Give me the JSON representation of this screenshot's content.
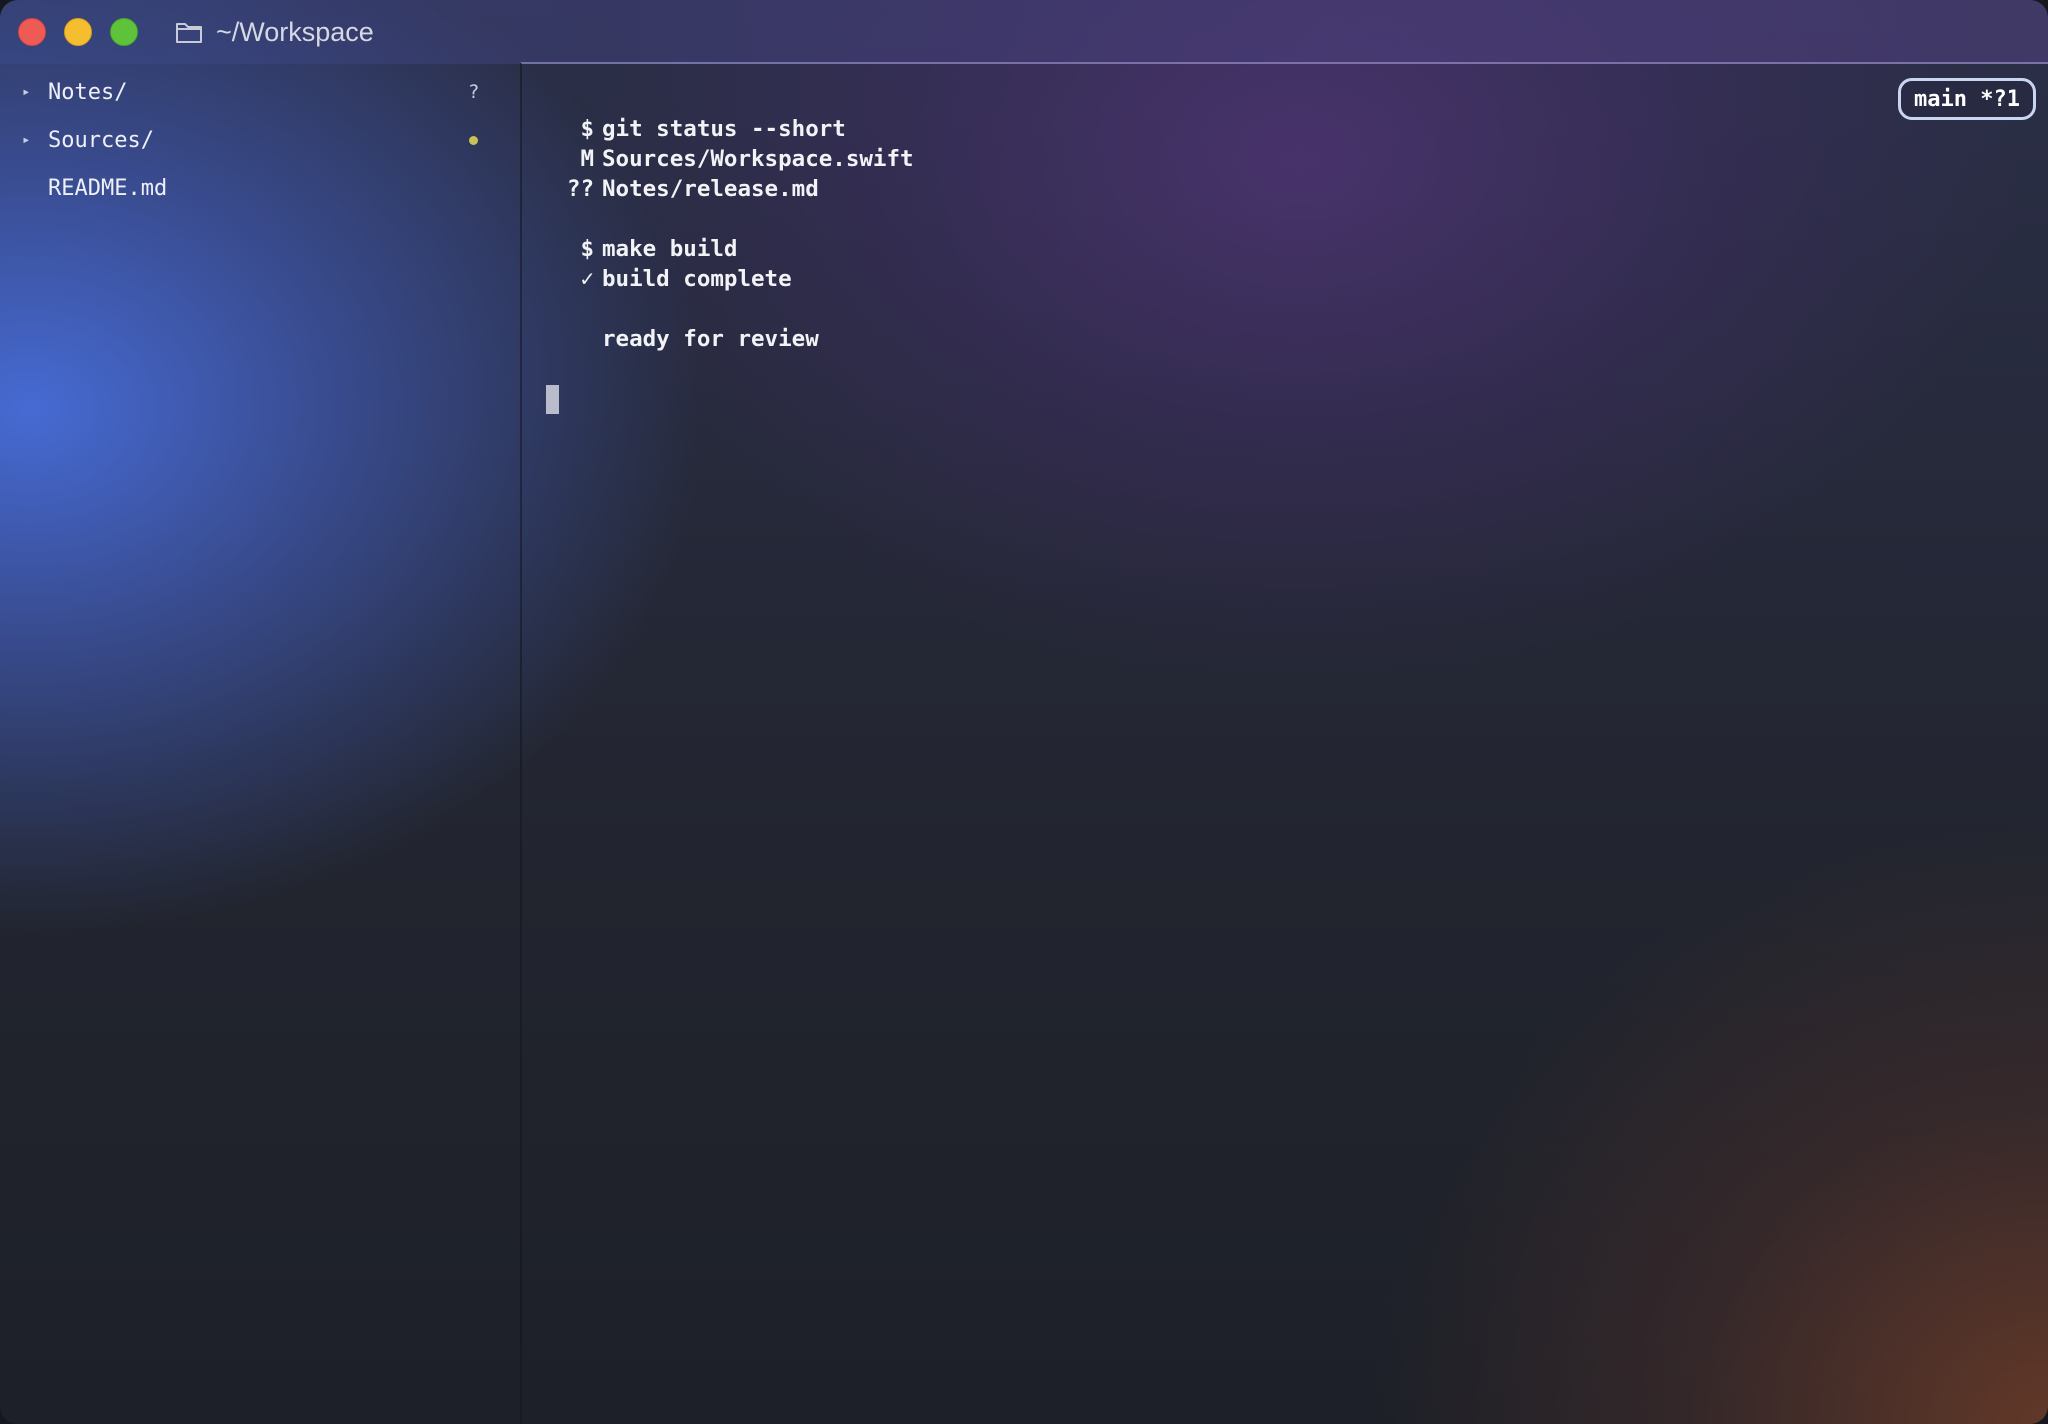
{
  "window": {
    "title": "~/Workspace",
    "folder_icon": "folder-icon"
  },
  "sidebar": {
    "items": [
      {
        "label": "Notes/",
        "expandable": true,
        "status": "?"
      },
      {
        "label": "Sources/",
        "expandable": true,
        "status": "●",
        "status_color": "#c9c256"
      },
      {
        "label": "README.md",
        "expandable": false,
        "status": ""
      }
    ]
  },
  "terminal": {
    "branch_badge": "main *?1",
    "lines": [
      {
        "gutter": "$",
        "text": "git status --short"
      },
      {
        "gutter": "M",
        "text": "Sources/Workspace.swift"
      },
      {
        "gutter": "??",
        "text": "Notes/release.md"
      },
      {
        "gutter": "",
        "text": ""
      },
      {
        "gutter": "$",
        "text": "make build"
      },
      {
        "gutter": "✓",
        "text": "build complete"
      },
      {
        "gutter": "",
        "text": ""
      },
      {
        "gutter": "",
        "text": "ready for review"
      }
    ]
  },
  "colors": {
    "close": "#ee5b55",
    "minimize": "#f5bd30",
    "maximize": "#5fc23b",
    "badge_border": "#c9d6f2"
  }
}
